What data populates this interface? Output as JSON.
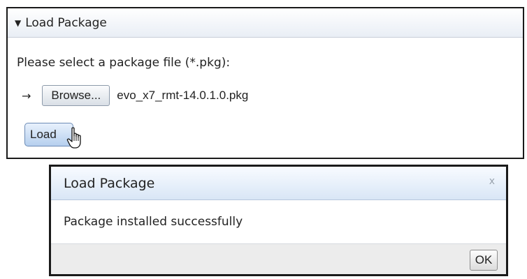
{
  "panel": {
    "title": "Load Package",
    "collapse_icon": "caret-down-icon",
    "prompt": "Please select a package file (*.pkg):",
    "arrow": "→",
    "browse_label": "Browse...",
    "filename": "evo_x7_rmt-14.0.1.0.pkg",
    "load_label": "Load",
    "cursor_icon": "hand-pointer-icon"
  },
  "dialog": {
    "title": "Load Package",
    "close_label": "x",
    "message": "Package installed successfully",
    "ok_label": "OK"
  }
}
